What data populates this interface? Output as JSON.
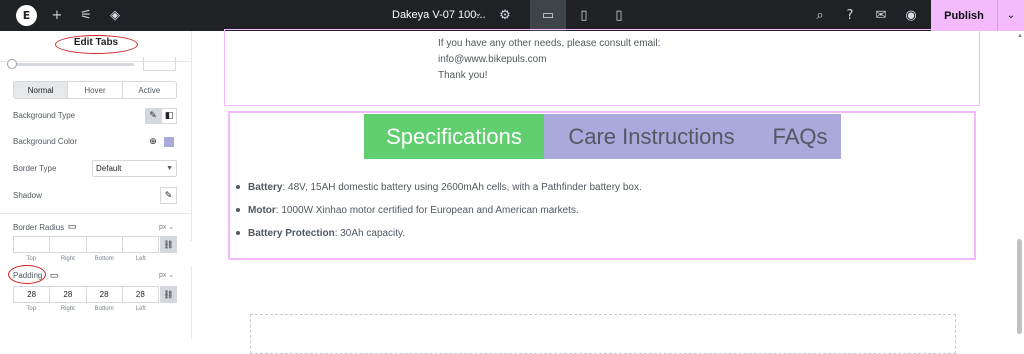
{
  "topbar": {
    "logo": "E",
    "page_title": "Dakeya V-07 100...",
    "publish_label": "Publish"
  },
  "panel": {
    "title": "Edit Tabs",
    "state_tabs": [
      "Normal",
      "Hover",
      "Active"
    ],
    "background_type_label": "Background Type",
    "background_color_label": "Background Color",
    "border_type_label": "Border Type",
    "border_type_value": "Default",
    "shadow_label": "Shadow",
    "border_radius_label": "Border Radius",
    "border_radius_unit": "px",
    "border_radius_values": [
      "",
      "",
      "",
      ""
    ],
    "padding_label": "Padding",
    "padding_unit": "px",
    "padding_values": [
      "28",
      "28",
      "28",
      "28"
    ],
    "dimension_labels": [
      "Top",
      "Right",
      "Bottom",
      "Left"
    ]
  },
  "canvas": {
    "contact_lines": [
      "If you have any other needs, please consult email:",
      "info@www.bikepuls.com",
      "Thank you!"
    ],
    "tabs": [
      {
        "label": "Specifications",
        "active": true
      },
      {
        "label": "Care Instructions",
        "active": false
      },
      {
        "label": "FAQs",
        "active": false
      }
    ],
    "specs": [
      {
        "term": "Battery",
        "text": ": 48V, 15AH domestic battery using 2600mAh cells, with a Pathfinder battery box."
      },
      {
        "term": "Motor",
        "text": ": 1000W Xinhao motor certified for European and American markets."
      },
      {
        "term": "Battery Protection",
        "text": ": 30Ah capacity."
      }
    ]
  },
  "colors": {
    "topbar_bg": "#1f2124",
    "publish_bg": "#f3bafd",
    "tab_active_bg": "#61ce70",
    "tab_inactive_bg": "#a9a9dc",
    "highlight_ring": "#d02020"
  }
}
